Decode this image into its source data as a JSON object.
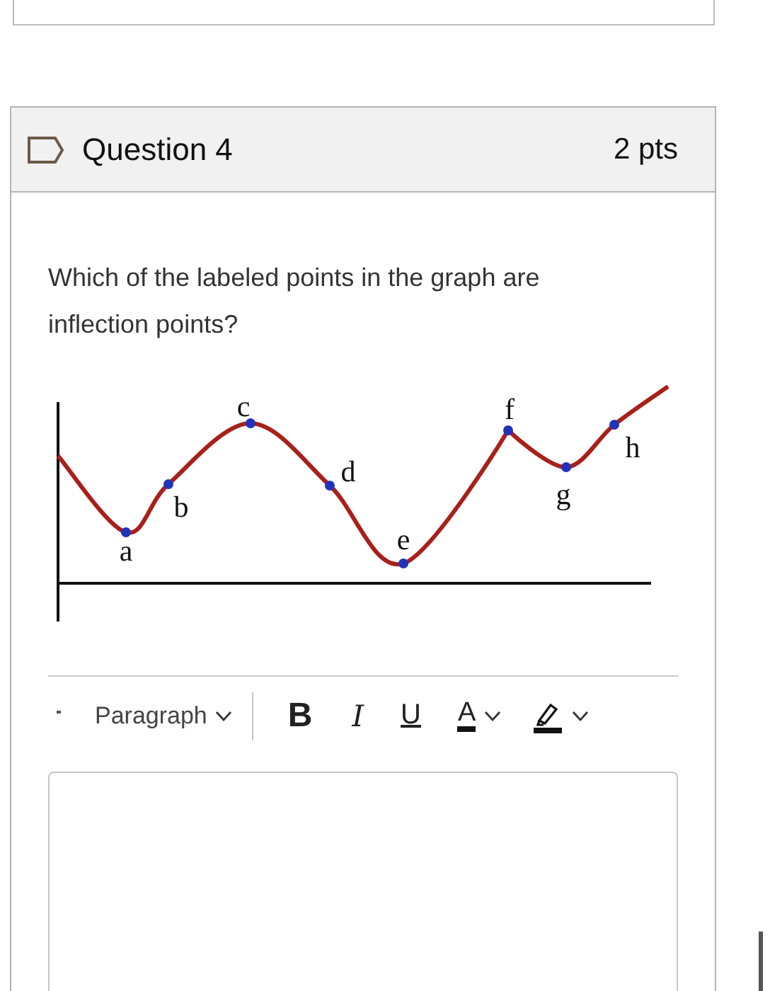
{
  "question": {
    "title": "Question 4",
    "points": "2 pts",
    "text": "Which of the labeled points in the graph are inflection points?",
    "graph_labels": [
      "a",
      "b",
      "c",
      "d",
      "e",
      "f",
      "g",
      "h"
    ]
  },
  "toolbar": [
    {
      "kind": "block-format",
      "label": "Paragraph",
      "dropdown": true
    },
    {
      "kind": "bold",
      "label": "B",
      "dropdown": false
    },
    {
      "kind": "italic",
      "label": "I",
      "dropdown": false
    },
    {
      "kind": "underline",
      "label": "U",
      "dropdown": false
    },
    {
      "kind": "text-color",
      "label": "A",
      "dropdown": true
    },
    {
      "kind": "highlight",
      "dropdown": true
    }
  ]
}
